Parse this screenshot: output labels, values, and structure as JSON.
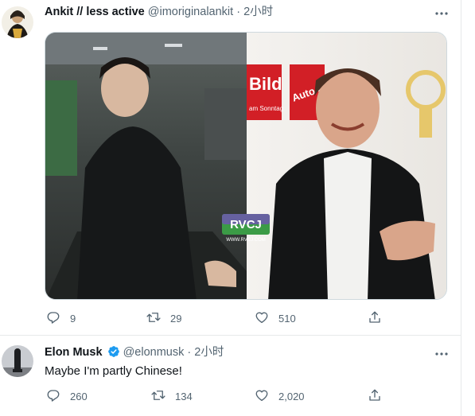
{
  "tweet1": {
    "display_name": "Ankit // less active",
    "handle": "@imoriginalankit",
    "separator": "·",
    "time": "2小时",
    "media_watermark": "RVCJ",
    "media_watermark_sub": "WWW.RVCJ.COM",
    "media_sign_1": "Bild",
    "media_sign_1_sub": "am Sonntag",
    "media_sign_2": "Auto Bild",
    "replies": "9",
    "retweets": "29",
    "likes": "510"
  },
  "tweet2": {
    "display_name": "Elon Musk",
    "handle": "@elonmusk",
    "separator": "·",
    "time": "2小时",
    "text": "Maybe I'm partly Chinese!",
    "replies": "260",
    "retweets": "134",
    "likes": "2,020"
  },
  "icons": {
    "reply": "reply-icon",
    "retweet": "retweet-icon",
    "like": "like-icon",
    "share": "share-icon",
    "more": "more-icon",
    "verified": "verified-badge-icon"
  },
  "colors": {
    "text": "#0f1419",
    "secondary": "#536471",
    "verified": "#1d9bf0",
    "border": "#e7e9ea"
  }
}
